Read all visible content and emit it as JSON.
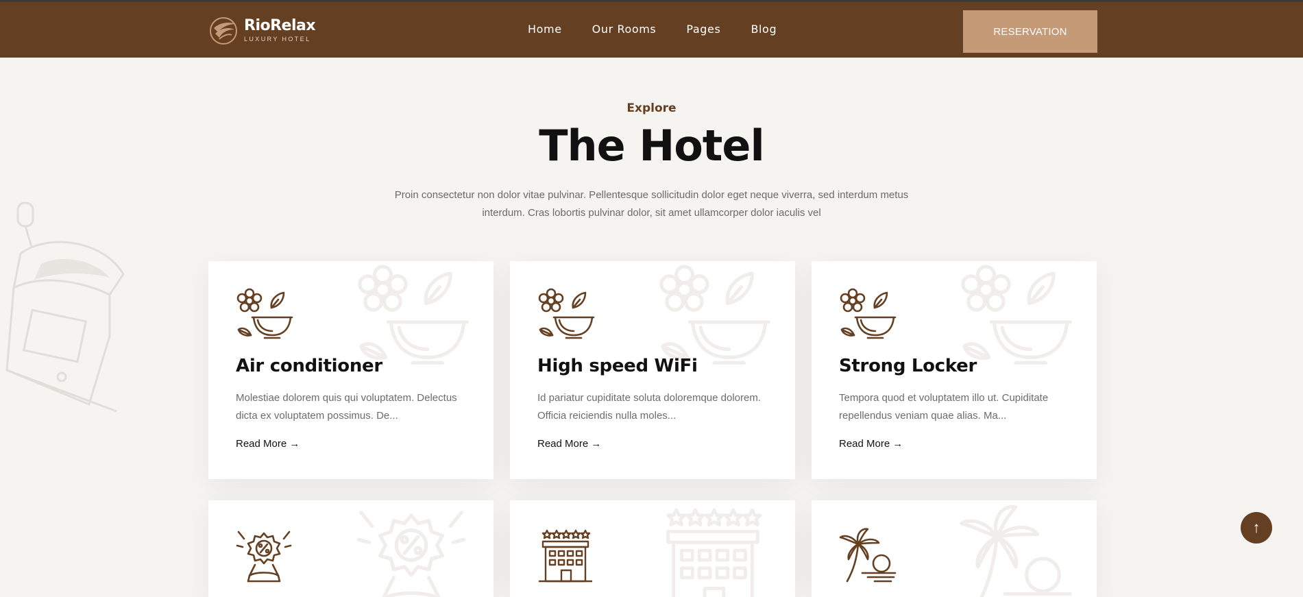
{
  "header": {
    "logo_name": "RioRelax",
    "logo_tag": "LUXURY HOTEL",
    "nav": [
      "Home",
      "Our Rooms",
      "Pages",
      "Blog"
    ],
    "reservation_label": "RESERVATION"
  },
  "section": {
    "eyebrow": "Explore",
    "title": "The Hotel",
    "description": "Proin consectetur non dolor vitae pulvinar. Pellentesque sollicitudin dolor eget neque viverra, sed interdum metus interdum. Cras lobortis pulvinar dolor, sit amet ullamcorper dolor iaculis vel"
  },
  "cards": [
    {
      "title": "Air conditioner",
      "text": "Molestiae dolorem quis qui voluptatem. Delectus dicta ex voluptatem possimus. De...",
      "more": "Read More",
      "icon": "spa-bowl-icon"
    },
    {
      "title": "High speed WiFi",
      "text": "Id pariatur cupiditate soluta doloremque dolorem. Officia reiciendis nulla moles...",
      "more": "Read More",
      "icon": "spa-bowl-icon"
    },
    {
      "title": "Strong Locker",
      "text": "Tempora quod et voluptatem illo ut. Cupiditate repellendus veniam quae alias. Ma...",
      "more": "Read More",
      "icon": "spa-bowl-icon"
    },
    {
      "icon": "discount-badge-icon"
    },
    {
      "icon": "five-star-hotel-icon"
    },
    {
      "icon": "palm-beach-icon"
    }
  ],
  "colors": {
    "brand": "#643f21",
    "accent": "#c49a77",
    "background": "#f5f4f1"
  },
  "arrow_glyph": "→",
  "scroll_top_glyph": "↑"
}
